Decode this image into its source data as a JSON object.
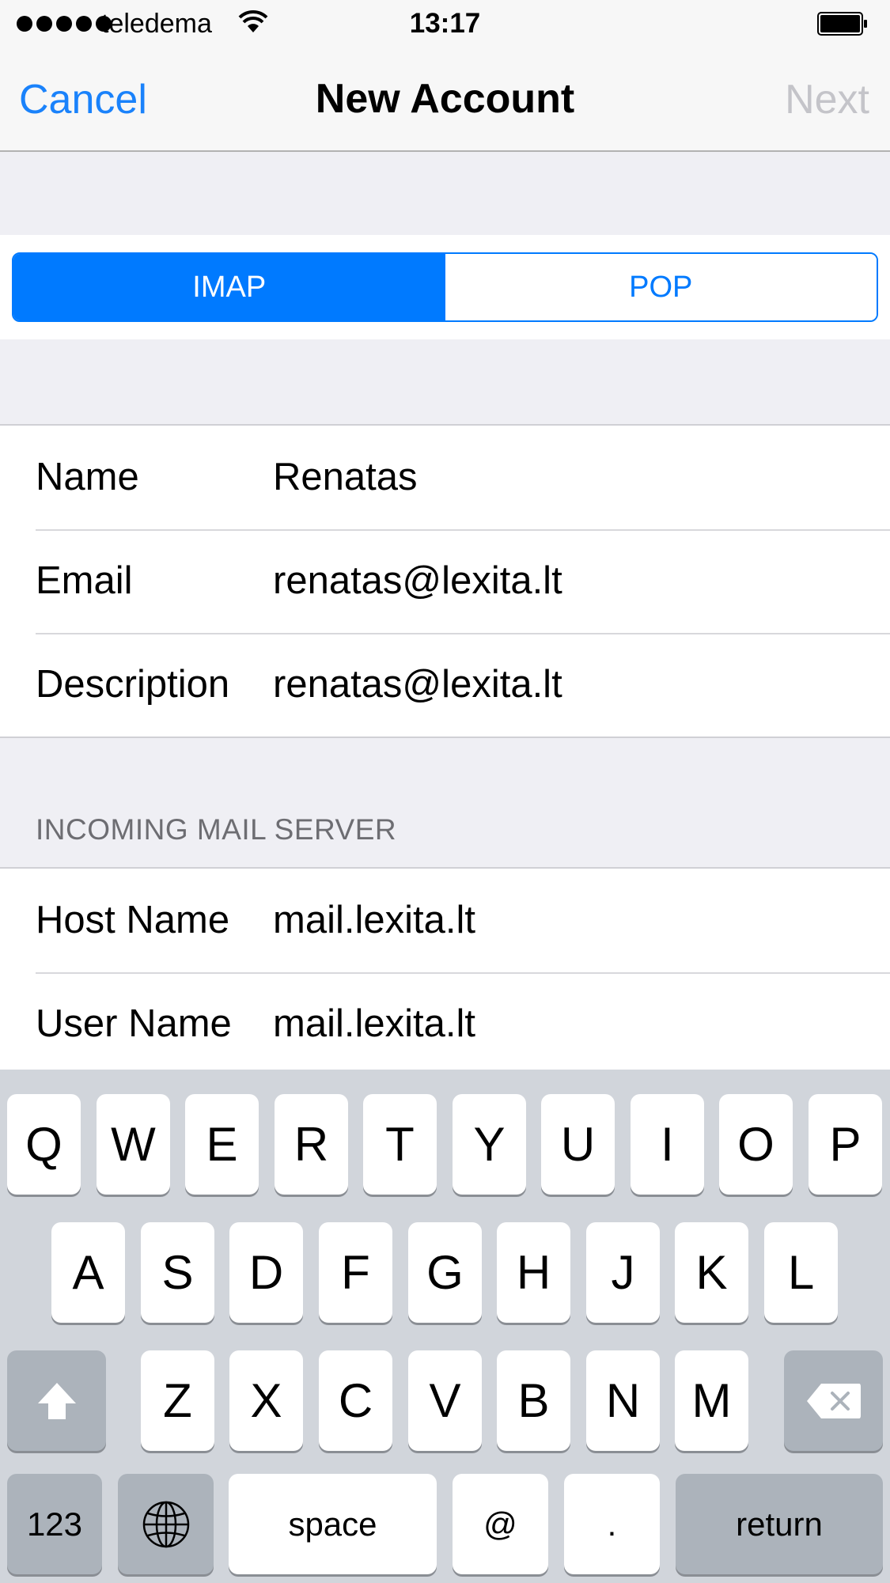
{
  "status_bar": {
    "carrier": "teledema",
    "time": "13:17",
    "signal_bars": 5,
    "icons": [
      "wifi-icon",
      "battery-icon"
    ]
  },
  "nav": {
    "cancel": "Cancel",
    "title": "New Account",
    "next": "Next"
  },
  "segment": {
    "options": [
      "IMAP",
      "POP"
    ],
    "selected": "IMAP"
  },
  "account": {
    "rows": [
      {
        "label": "Name",
        "value": "Renatas"
      },
      {
        "label": "Email",
        "value": "renatas@lexita.lt"
      },
      {
        "label": "Description",
        "value": "renatas@lexita.lt"
      }
    ]
  },
  "incoming": {
    "header": "INCOMING MAIL SERVER",
    "rows": [
      {
        "label": "Host Name",
        "value": "mail.lexita.lt"
      },
      {
        "label": "User Name",
        "value": "mail.lexita.lt"
      }
    ]
  },
  "keyboard": {
    "row1": [
      "Q",
      "W",
      "E",
      "R",
      "T",
      "Y",
      "U",
      "I",
      "O",
      "P"
    ],
    "row2": [
      "A",
      "S",
      "D",
      "F",
      "G",
      "H",
      "J",
      "K",
      "L"
    ],
    "row3": [
      "Z",
      "X",
      "C",
      "V",
      "B",
      "N",
      "M"
    ],
    "numbers_key": "123",
    "space_key": "space",
    "at_key": "@",
    "dot_key": ".",
    "return_key": "return",
    "icons": [
      "shift-icon",
      "backspace-icon",
      "globe-icon"
    ]
  },
  "colors": {
    "accent": "#007aff",
    "nav_link": "#1a82fb",
    "disabled": "#c4c4c9",
    "background": "#efeff4",
    "keyboard_bg": "#d1d5db",
    "dark_key": "#acb3bb"
  }
}
